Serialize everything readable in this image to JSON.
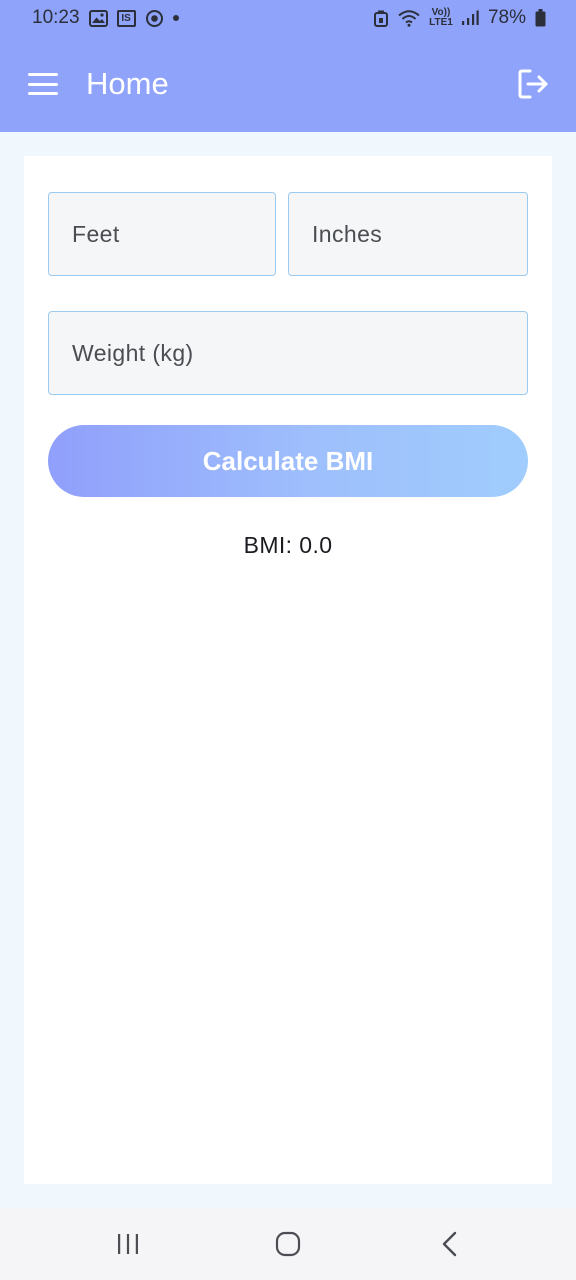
{
  "status_bar": {
    "time": "10:23",
    "left_icons": [
      "gallery-icon",
      "is-badge-icon",
      "sync-circle-icon",
      "dot-icon"
    ],
    "is_badge_text": "IS",
    "network_tag": "Vo)) LTE1",
    "battery_percent": "78%",
    "right_icons": [
      "lock-battery-icon",
      "wifi-icon",
      "signal-icon",
      "battery-icon"
    ]
  },
  "app_bar": {
    "title": "Home",
    "menu_icon": "hamburger-menu-icon",
    "logout_icon": "logout-icon",
    "background": "#8fa3fb"
  },
  "form": {
    "feet_placeholder": "Feet",
    "inches_placeholder": "Inches",
    "weight_placeholder": "Weight (kg)",
    "feet_value": "",
    "inches_value": "",
    "weight_value": "",
    "field_border_color": "#9ccbf0"
  },
  "calculate_button": {
    "label": "Calculate BMI",
    "gradient_start": "#909ffb",
    "gradient_end": "#a0cdfd"
  },
  "result": {
    "text": "BMI: 0.0"
  },
  "nav_bar": {
    "recents_icon": "recents-icon",
    "home_icon": "home-icon",
    "back_icon": "back-icon"
  }
}
